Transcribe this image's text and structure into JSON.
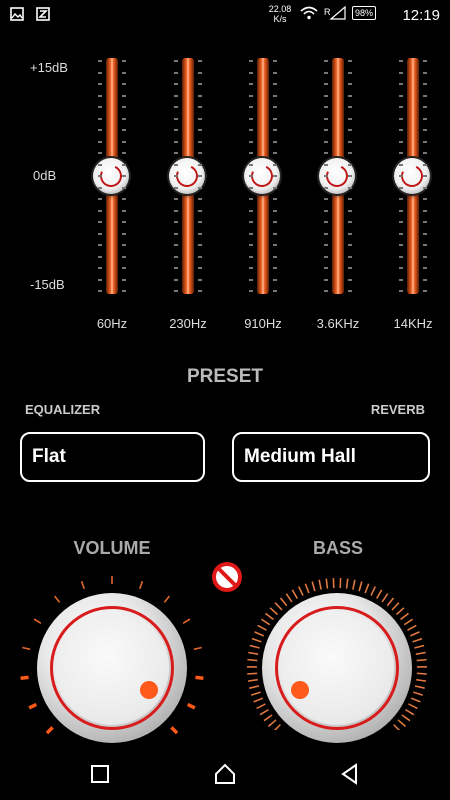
{
  "status_bar": {
    "net_speed": "22.08",
    "net_unit": "K/s",
    "battery": "98%",
    "time": "12:19",
    "left_icons": [
      "image-notification-icon",
      "z-app-notification-icon"
    ]
  },
  "equalizer": {
    "db_labels": {
      "top": "+15dB",
      "mid": "0dB",
      "bottom": "-15dB"
    },
    "bands": [
      {
        "freq": "60Hz",
        "gain_db": 0
      },
      {
        "freq": "230Hz",
        "gain_db": 0
      },
      {
        "freq": "910Hz",
        "gain_db": 0
      },
      {
        "freq": "3.6KHz",
        "gain_db": 0
      },
      {
        "freq": "14KHz",
        "gain_db": 0
      }
    ]
  },
  "preset": {
    "title": "PRESET",
    "equalizer_label": "EQUALIZER",
    "reverb_label": "REVERB",
    "equalizer_value": "Flat",
    "reverb_value": "Medium Hall"
  },
  "volume": {
    "title": "VOLUME"
  },
  "bass": {
    "title": "BASS"
  },
  "colors": {
    "accent": "#ff5a1a",
    "ring": "#d81c1c",
    "rail": "#c94a14"
  }
}
